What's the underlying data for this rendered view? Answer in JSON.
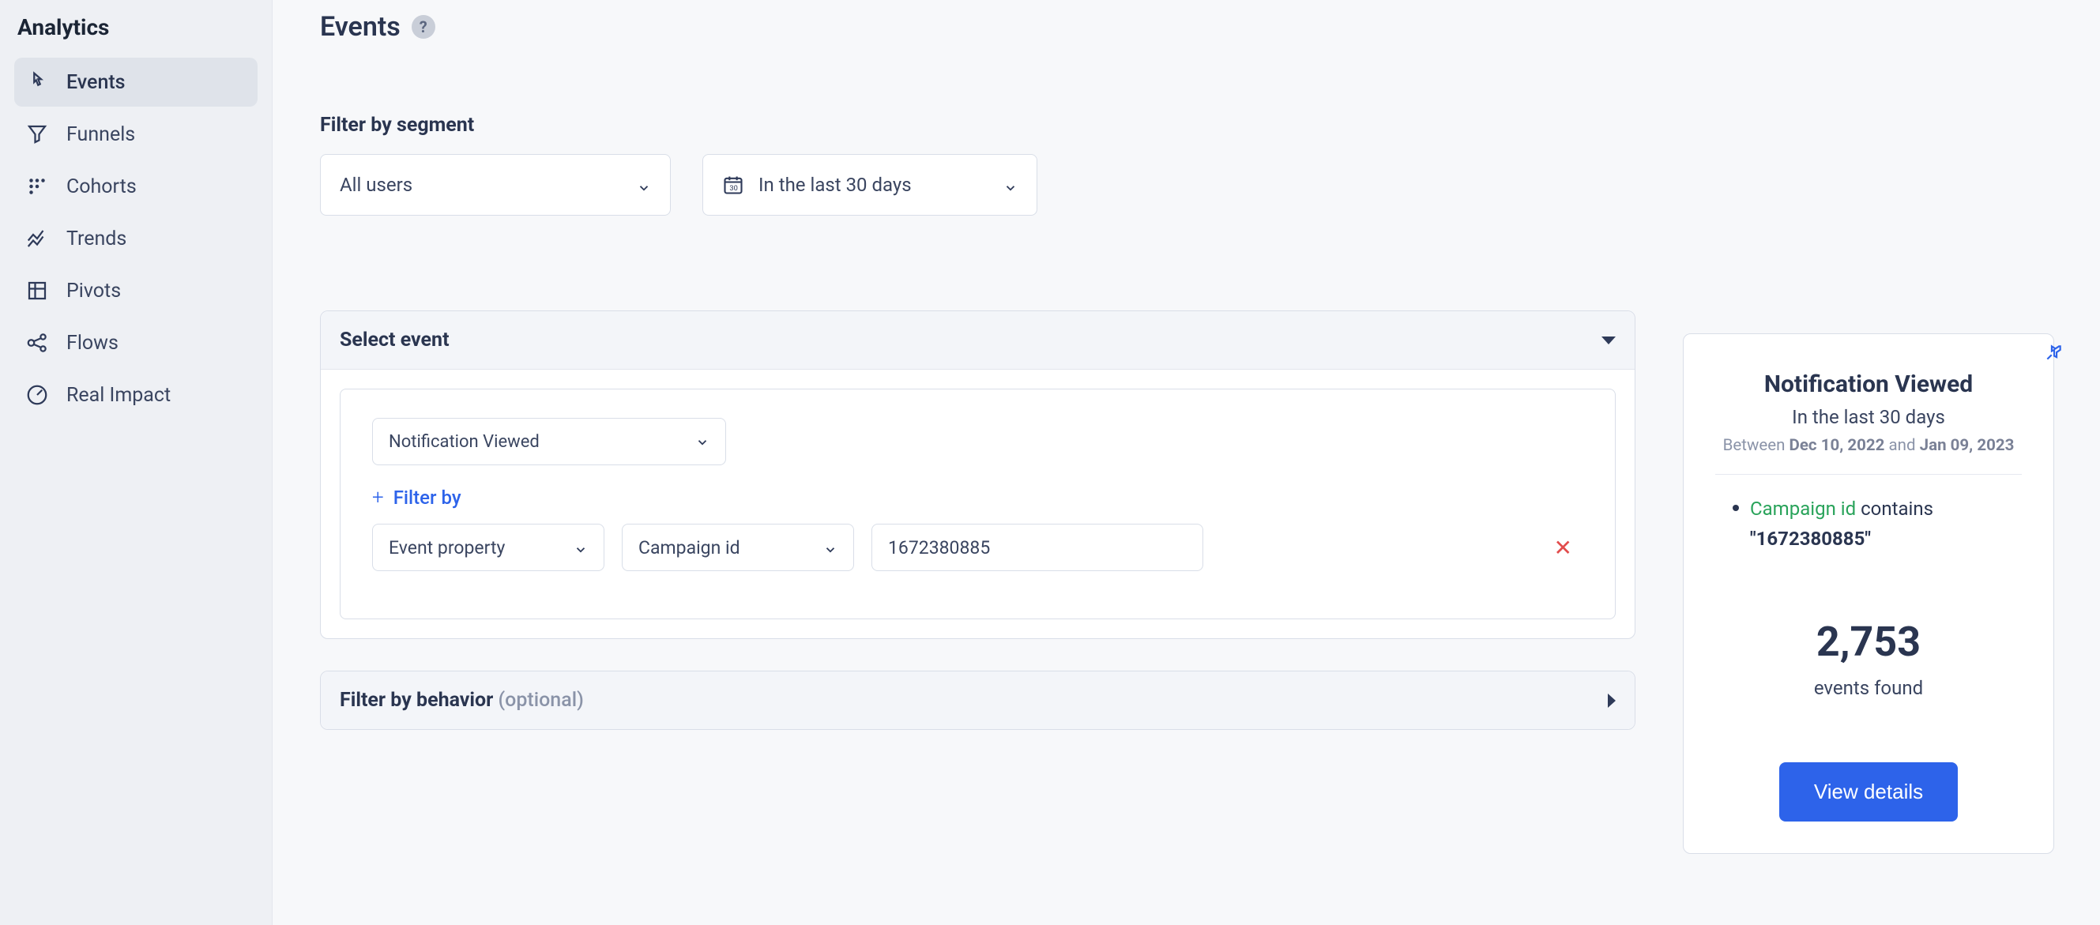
{
  "sidebar": {
    "title": "Analytics",
    "items": [
      {
        "label": "Events"
      },
      {
        "label": "Funnels"
      },
      {
        "label": "Cohorts"
      },
      {
        "label": "Trends"
      },
      {
        "label": "Pivots"
      },
      {
        "label": "Flows"
      },
      {
        "label": "Real Impact"
      }
    ]
  },
  "page": {
    "title": "Events"
  },
  "segment": {
    "label": "Filter by segment",
    "users_dropdown": "All users",
    "date_dropdown": "In the last 30 days"
  },
  "select_event": {
    "header": "Select event",
    "event_dropdown": "Notification Viewed",
    "filter_by_label": "Filter by",
    "property_type": "Event property",
    "property_name": "Campaign id",
    "property_value": "1672380885"
  },
  "behavior": {
    "header": "Filter by behavior",
    "optional": "(optional)"
  },
  "summary": {
    "title": "Notification Viewed",
    "subtitle": "In the last 30 days",
    "between": "Between",
    "and": "and",
    "date_from": "Dec 10, 2022",
    "date_to": "Jan 09, 2023",
    "filter_prop": "Campaign id",
    "filter_verb": "contains",
    "filter_value": "\"1672380885\"",
    "count": "2,753",
    "events_found": "events found",
    "view_button": "View details"
  }
}
